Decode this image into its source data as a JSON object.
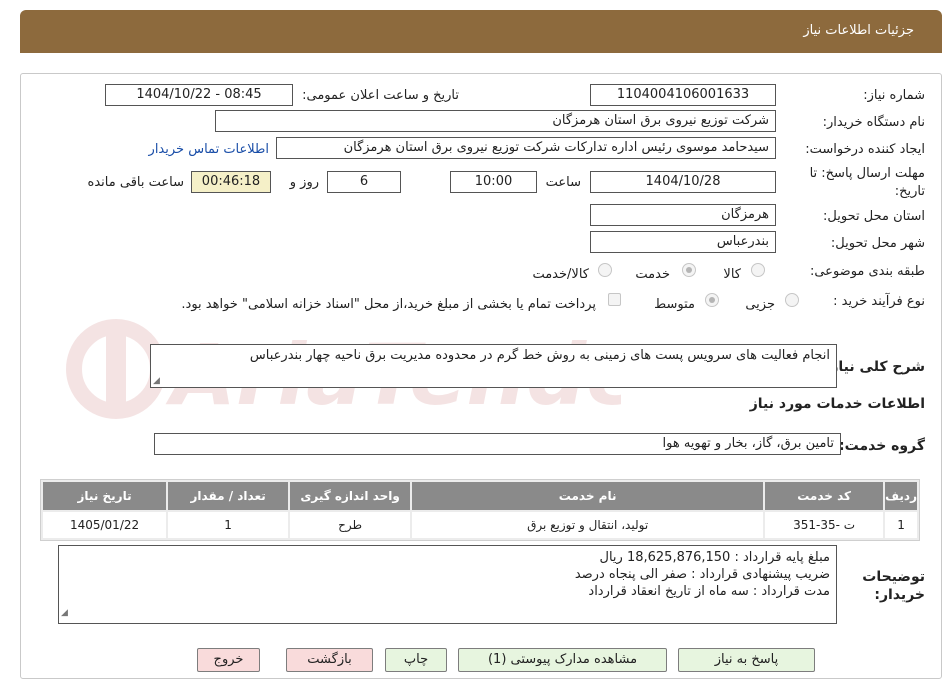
{
  "header": {
    "title": "جزئیات اطلاعات نیاز"
  },
  "form": {
    "need_number_label": "شماره نیاز:",
    "need_number": "1104004106001633",
    "announce_label": "تاریخ و ساعت اعلان عمومی:",
    "announce_value": "1404/10/22 - 08:45",
    "buyer_label": "نام دستگاه خریدار:",
    "buyer_value": "شرکت توزیع نیروی برق استان هرمزگان",
    "requester_label": "ایجاد کننده درخواست:",
    "requester_value": "سیدحامد موسوی رئیس اداره تدارکات شرکت توزیع نیروی برق استان هرمزگان",
    "contact_link": "اطلاعات تماس خریدار",
    "deadline_label_line1": "مهلت ارسال پاسخ: تا",
    "deadline_label_line2": "تاریخ:",
    "deadline_date": "1404/10/28",
    "time_label": "ساعت",
    "deadline_time": "10:00",
    "days_value": "6",
    "days_label": "روز و",
    "remaining_time": "00:46:18",
    "remaining_label": "ساعت باقی مانده",
    "province_label": "استان محل تحویل:",
    "province_value": "هرمزگان",
    "city_label": "شهر محل تحویل:",
    "city_value": "بندرعباس",
    "category_label": "طبقه بندی موضوعی:",
    "category_options": [
      "کالا",
      "خدمت",
      "کالا/خدمت"
    ],
    "category_selected": "خدمت",
    "process_label": "نوع فرآیند خرید :",
    "process_options": [
      "جزیی",
      "متوسط"
    ],
    "process_selected": "متوسط",
    "payment_note": "پرداخت تمام یا بخشی از مبلغ خرید،از محل \"اسناد خزانه اسلامی\" خواهد بود."
  },
  "description": {
    "label": "شرح کلی نیاز:",
    "value": "انجام فعالیت های سرویس پست های زمینی به روش خط گرم در محدوده مدیریت برق ناحیه چهار بندرعباس"
  },
  "services": {
    "section_title": "اطلاعات خدمات مورد نیاز",
    "group_label": "گروه خدمت:",
    "group_value": "تامین برق، گاز، بخار و تهویه هوا",
    "columns": [
      "ردیف",
      "کد خدمت",
      "نام خدمت",
      "واحد اندازه گیری",
      "تعداد / مقدار",
      "تاریخ نیاز"
    ],
    "rows": [
      [
        "1",
        "ت -35-351",
        "تولید، انتقال و توزیع برق",
        "طرح",
        "1",
        "1405/01/22"
      ]
    ]
  },
  "buyer_notes": {
    "label_line1": "توضیحات",
    "label_line2": "خریدار:",
    "lines": [
      "مبلغ پایه قرارداد : 18,625,876,150 ریال",
      "ضریب پیشنهادی قرارداد : صفر الی پنجاه درصد",
      "مدت قرارداد :  سه ماه از تاریخ انعقاد قرارداد"
    ]
  },
  "buttons": {
    "reply": "پاسخ به نیاز",
    "attachments": "مشاهده مدارک پیوستی (1)",
    "print": "چاپ",
    "back": "بازگشت",
    "exit": "خروج"
  },
  "colors": {
    "header_bg": "#8d6a3d",
    "table_header_bg": "#8a8a8a",
    "remaining_bg": "#f5f0c8",
    "green_btn": "#e7f5df",
    "pink_btn": "#f9dbdb"
  }
}
